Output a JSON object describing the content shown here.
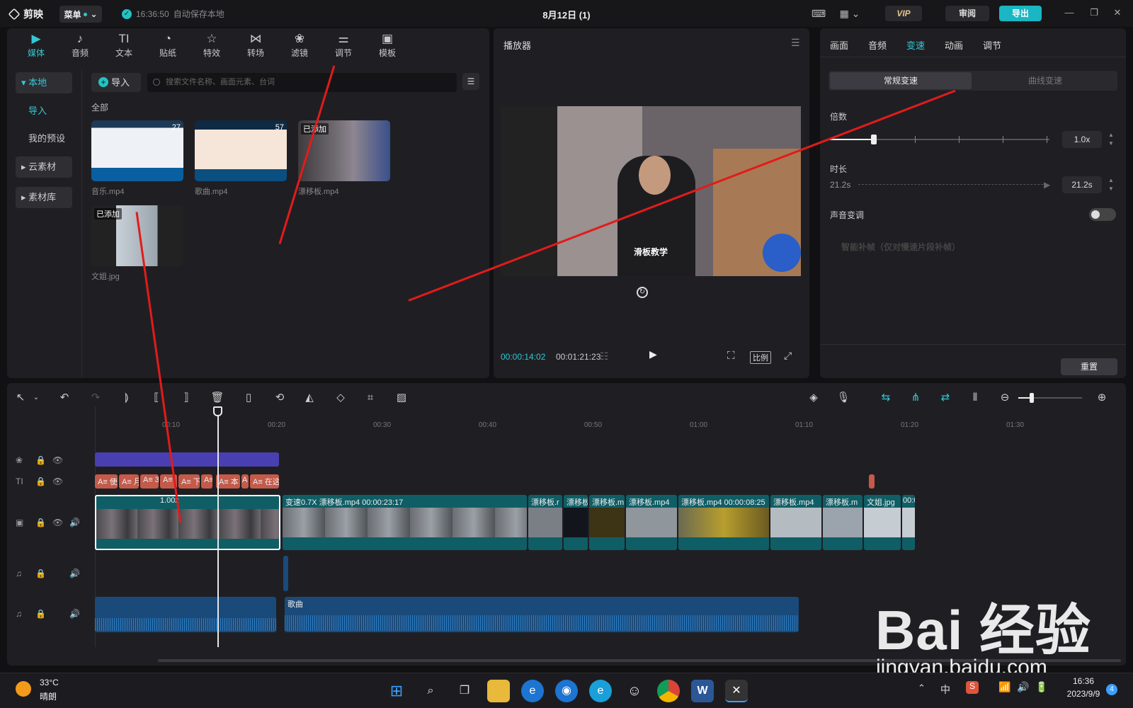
{
  "titlebar": {
    "app_name": "剪映",
    "menu_label": "菜单",
    "save_time": "16:36:50",
    "save_text": "自动保存本地",
    "doc_title": "8月12日 (1)",
    "vip_label": "VIP",
    "review_label": "审阅",
    "export_label": "导出"
  },
  "media": {
    "categories": [
      {
        "label": "媒体",
        "icon": "media-icon"
      },
      {
        "label": "音频",
        "icon": "audio-icon"
      },
      {
        "label": "文本",
        "icon": "text-icon"
      },
      {
        "label": "贴纸",
        "icon": "sticker-icon"
      },
      {
        "label": "特效",
        "icon": "effects-icon"
      },
      {
        "label": "转场",
        "icon": "transition-icon"
      },
      {
        "label": "滤镜",
        "icon": "filter-icon"
      },
      {
        "label": "调节",
        "icon": "adjust-icon"
      },
      {
        "label": "模板",
        "icon": "template-icon"
      }
    ],
    "sidebar": [
      "本地",
      "导入",
      "我的预设",
      "云素材",
      "素材库"
    ],
    "import_label": "导入",
    "search_placeholder": "搜索文件名称、画面元素、台词",
    "section_label": "全部",
    "files": [
      {
        "name": "音乐.mp4",
        "duration": "27",
        "badge": ""
      },
      {
        "name": "歌曲.mp4",
        "duration": "57",
        "badge": ""
      },
      {
        "name": "漂移板.mp4",
        "duration": "",
        "badge": "已添加"
      },
      {
        "name": "文姐.jpg",
        "duration": "",
        "badge": "已添加"
      }
    ]
  },
  "player": {
    "title": "播放器",
    "subtitle_text": "滑板教学",
    "current_time": "00:00:14:02",
    "total_time": "00:01:21:23",
    "ratio_label": "比例"
  },
  "inspector": {
    "tabs": [
      "画面",
      "音频",
      "变速",
      "动画",
      "调节"
    ],
    "active_tab": "变速",
    "mode_normal": "常规变速",
    "mode_curve": "曲线变速",
    "speed_label": "倍数",
    "speed_value": "1.0x",
    "speed_fraction": 0.2,
    "duration_label": "时长",
    "duration_from": "21.2s",
    "duration_value": "21.2s",
    "pitch_label": "声音变调",
    "smart_fill": "智能补帧（仅对慢速片段补帧）",
    "reset_label": "重置"
  },
  "timeline": {
    "ruler": [
      "00:10",
      "00:20",
      "00:30",
      "00:40",
      "00:50",
      "01:00",
      "01:10",
      "01:20",
      "01:30"
    ],
    "clip1_speed": "1.00x",
    "clip2_label": "变速0.7X   漂移板.mp4   00:00:23:17",
    "clip_labels": [
      "漂移板.r",
      "漂移板",
      "漂移板.m",
      "漂移板.mp4",
      "漂移板.mp4   00:00:08:25",
      "漂移板.mp4",
      "漂移板.m",
      "文姐.jpg",
      "00:0"
    ],
    "text_clips": [
      "A≡ 使",
      "A≡ 月",
      "A≡ 3",
      "A≡",
      "A≡ 下",
      "A≡",
      "A≡ 本",
      "A",
      "A≡ 在这"
    ],
    "audio_label": "歌曲"
  },
  "taskbar": {
    "temp": "33°C",
    "weather": "晴朗",
    "ime": "中",
    "time": "16:36",
    "date": "2023/9/9",
    "notif_count": "4"
  },
  "watermark": {
    "brand": "Bai 经验",
    "url": "jingyan.baidu.com"
  },
  "colors": {
    "accent": "#35c8d6",
    "arrow": "#e21b1b",
    "video_track": "#0f5e66",
    "text_track": "#c45a4a",
    "effect_track": "#4a3fb0",
    "audio_track": "#1a4a7a"
  }
}
